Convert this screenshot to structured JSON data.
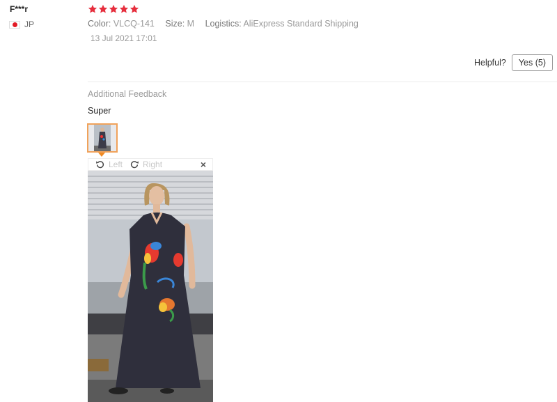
{
  "review": {
    "user_name": "F***r",
    "country": "JP",
    "rating": 5,
    "attributes": [
      {
        "key": "Color:",
        "value": "VLCQ-141"
      },
      {
        "key": "Size:",
        "value": "M"
      },
      {
        "key": "Logistics:",
        "value": "AliExpress Standard Shipping"
      }
    ],
    "date": "13 Jul 2021 17:01",
    "helpful_label": "Helpful?",
    "yes_label": "Yes (5)",
    "additional_title": "Additional Feedback",
    "additional_text": "Super"
  },
  "viewer": {
    "rotate_left_label": "Left",
    "rotate_right_label": "Right",
    "close_symbol": "×"
  },
  "colors": {
    "star": "#e62e3d",
    "thumb_border": "#f0a25a",
    "flag_red": "#e21b26"
  }
}
